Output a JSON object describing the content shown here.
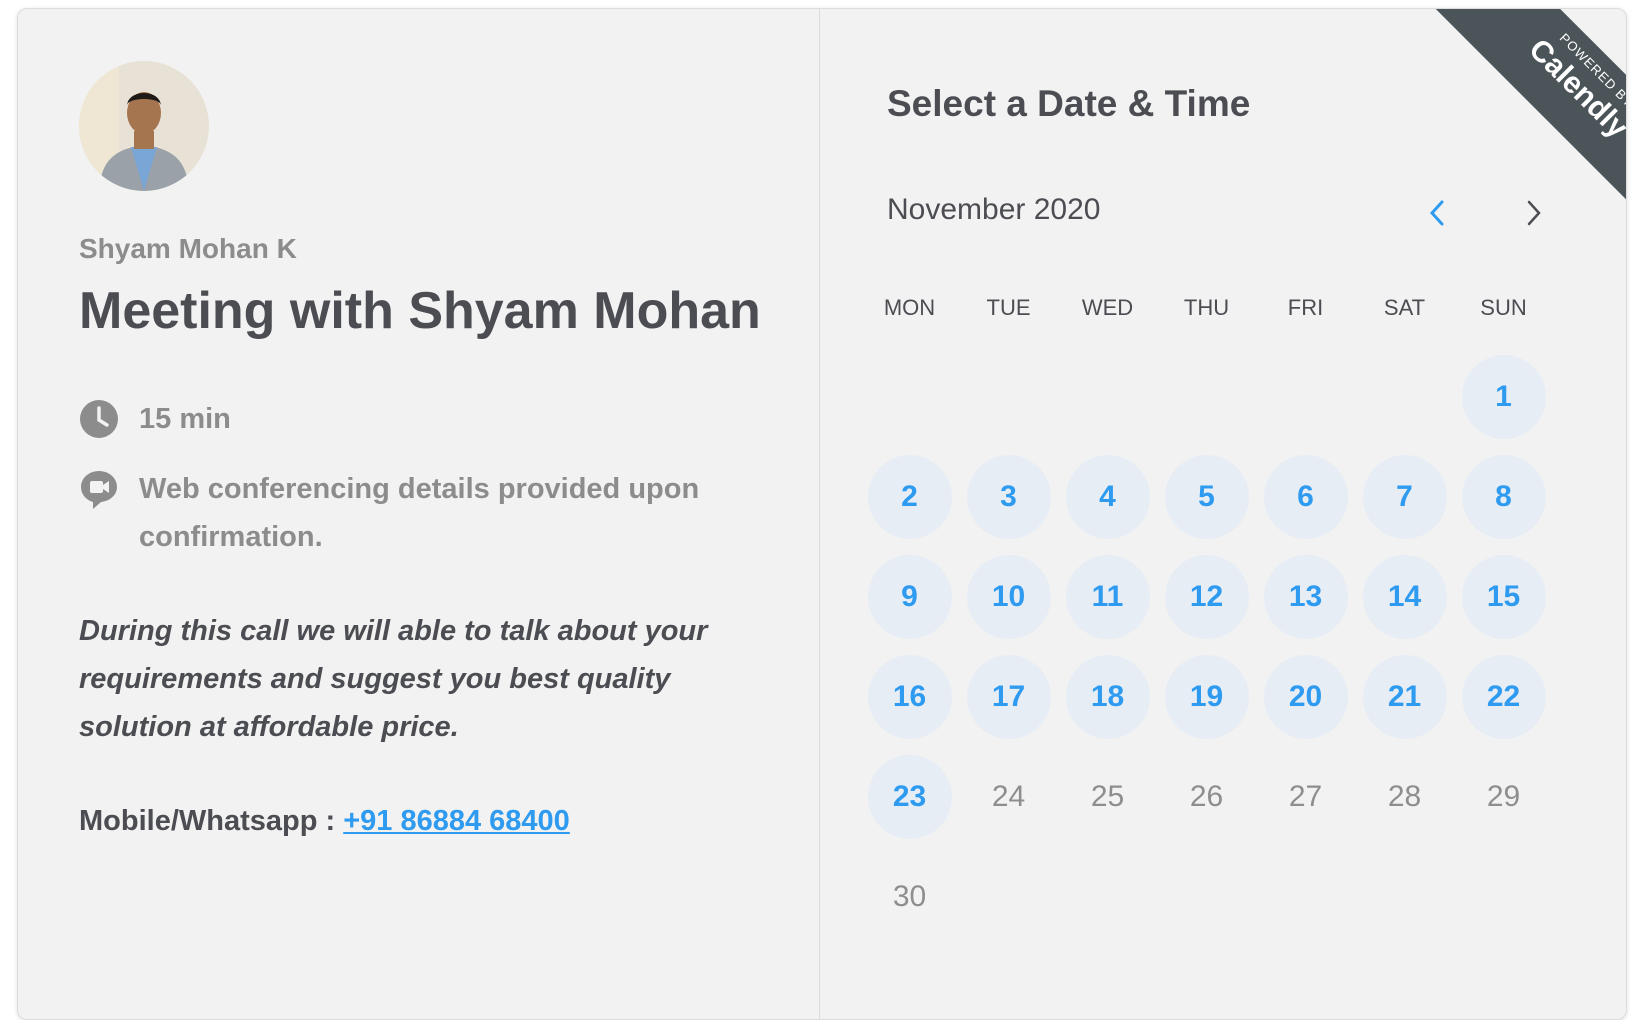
{
  "host": {
    "name": "Shyam Mohan K",
    "avatar_alt": "host-avatar"
  },
  "event": {
    "title": "Meeting with Shyam Mohan",
    "duration": "15 min",
    "conferencing": "Web conferencing details provided upon confirmation.",
    "description": "During this call we will able to talk about your requirements and suggest you best quality solution at affordable price.",
    "contact_label": "Mobile/Whatsapp : ",
    "contact_phone": "+91 86884 68400"
  },
  "calendar": {
    "heading": "Select a Date & Time",
    "month_label": "November 2020",
    "weekdays": [
      "MON",
      "TUE",
      "WED",
      "THU",
      "FRI",
      "SAT",
      "SUN"
    ],
    "leading_blanks": 6,
    "days": [
      {
        "d": "1",
        "available": true
      },
      {
        "d": "2",
        "available": true
      },
      {
        "d": "3",
        "available": true
      },
      {
        "d": "4",
        "available": true
      },
      {
        "d": "5",
        "available": true
      },
      {
        "d": "6",
        "available": true
      },
      {
        "d": "7",
        "available": true
      },
      {
        "d": "8",
        "available": true
      },
      {
        "d": "9",
        "available": true
      },
      {
        "d": "10",
        "available": true
      },
      {
        "d": "11",
        "available": true
      },
      {
        "d": "12",
        "available": true
      },
      {
        "d": "13",
        "available": true
      },
      {
        "d": "14",
        "available": true
      },
      {
        "d": "15",
        "available": true
      },
      {
        "d": "16",
        "available": true
      },
      {
        "d": "17",
        "available": true
      },
      {
        "d": "18",
        "available": true
      },
      {
        "d": "19",
        "available": true
      },
      {
        "d": "20",
        "available": true
      },
      {
        "d": "21",
        "available": true
      },
      {
        "d": "22",
        "available": true
      },
      {
        "d": "23",
        "available": true
      },
      {
        "d": "24",
        "available": false
      },
      {
        "d": "25",
        "available": false
      },
      {
        "d": "26",
        "available": false
      },
      {
        "d": "27",
        "available": false
      },
      {
        "d": "28",
        "available": false
      },
      {
        "d": "29",
        "available": false
      },
      {
        "d": "30",
        "available": false
      }
    ]
  },
  "branding": {
    "powered_by": "POWERED BY",
    "brand": "Calendly"
  },
  "colors": {
    "accent": "#2f9bf0",
    "available_bg": "#e6edf5",
    "ribbon": "#4b5458",
    "panel_bg": "#f2f2f2"
  },
  "icons": {
    "prev": "chevron-left-icon",
    "next": "chevron-right-icon",
    "duration": "clock-icon",
    "conferencing": "video-chat-icon"
  }
}
